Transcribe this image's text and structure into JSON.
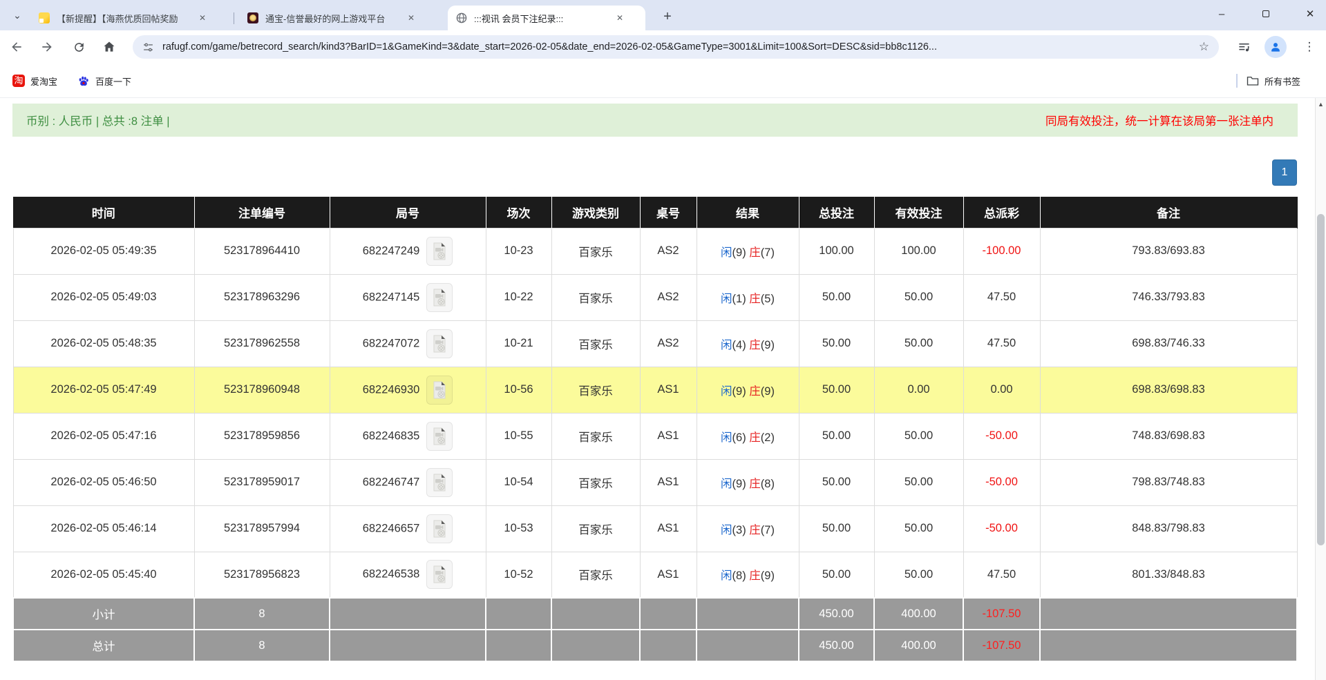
{
  "icons": {
    "chevron_down": "⌄",
    "close": "✕",
    "new_tab": "+",
    "minimize": "–",
    "star": "☆",
    "menu_dots": "⋮",
    "scroll_up": "▲",
    "taobao_glyph": "淘"
  },
  "browser": {
    "tabs": [
      {
        "title": "【新提醒】【海燕优质回帖奖励"
      },
      {
        "title": "通宝-信誉最好的网上游戏平台"
      },
      {
        "title": ":::视讯 会员下注纪录:::"
      }
    ],
    "url": "rafugf.com/game/betrecord_search/kind3?BarID=1&GameKind=3&date_start=2026-02-05&date_end=2026-02-05&GameType=3001&Limit=100&Sort=DESC&sid=bb8c1126...",
    "bookmarks": [
      "爱淘宝",
      "百度一下"
    ],
    "bookmarks_all": "所有书签"
  },
  "page": {
    "currency_summary": "币别 : 人民币 | 总共 :8 注单 |",
    "notice": "同局有效投注，统一计算在该局第一张注单内",
    "pagination": "1"
  },
  "table": {
    "headers": [
      "时间",
      "注单编号",
      "局号",
      "场次",
      "游戏类别",
      "桌号",
      "结果",
      "总投注",
      "有效投注",
      "总派彩",
      "备注"
    ],
    "rows": [
      {
        "time": "2026-02-05 05:49:35",
        "bet_id": "523178964410",
        "round_id": "682247249",
        "session": "10-23",
        "game_type": "百家乐",
        "table_no": "AS2",
        "result": {
          "pl": "闲",
          "pn": "(9)",
          "bl": "庄",
          "bn": "(7)"
        },
        "total_bet": "100.00",
        "valid_bet": "100.00",
        "payout": "-100.00",
        "remark": "793.83/693.83",
        "highlight": false
      },
      {
        "time": "2026-02-05 05:49:03",
        "bet_id": "523178963296",
        "round_id": "682247145",
        "session": "10-22",
        "game_type": "百家乐",
        "table_no": "AS2",
        "result": {
          "pl": "闲",
          "pn": "(1)",
          "bl": "庄",
          "bn": "(5)"
        },
        "total_bet": "50.00",
        "valid_bet": "50.00",
        "payout": "47.50",
        "remark": "746.33/793.83",
        "highlight": false
      },
      {
        "time": "2026-02-05 05:48:35",
        "bet_id": "523178962558",
        "round_id": "682247072",
        "session": "10-21",
        "game_type": "百家乐",
        "table_no": "AS2",
        "result": {
          "pl": "闲",
          "pn": "(4)",
          "bl": "庄",
          "bn": "(9)"
        },
        "total_bet": "50.00",
        "valid_bet": "50.00",
        "payout": "47.50",
        "remark": "698.83/746.33",
        "highlight": false
      },
      {
        "time": "2026-02-05 05:47:49",
        "bet_id": "523178960948",
        "round_id": "682246930",
        "session": "10-56",
        "game_type": "百家乐",
        "table_no": "AS1",
        "result": {
          "pl": "闲",
          "pn": "(9)",
          "bl": "庄",
          "bn": "(9)"
        },
        "total_bet": "50.00",
        "valid_bet": "0.00",
        "payout": "0.00",
        "remark": "698.83/698.83",
        "highlight": true
      },
      {
        "time": "2026-02-05 05:47:16",
        "bet_id": "523178959856",
        "round_id": "682246835",
        "session": "10-55",
        "game_type": "百家乐",
        "table_no": "AS1",
        "result": {
          "pl": "闲",
          "pn": "(6)",
          "bl": "庄",
          "bn": "(2)"
        },
        "total_bet": "50.00",
        "valid_bet": "50.00",
        "payout": "-50.00",
        "remark": "748.83/698.83",
        "highlight": false
      },
      {
        "time": "2026-02-05 05:46:50",
        "bet_id": "523178959017",
        "round_id": "682246747",
        "session": "10-54",
        "game_type": "百家乐",
        "table_no": "AS1",
        "result": {
          "pl": "闲",
          "pn": "(9)",
          "bl": "庄",
          "bn": "(8)"
        },
        "total_bet": "50.00",
        "valid_bet": "50.00",
        "payout": "-50.00",
        "remark": "798.83/748.83",
        "highlight": false
      },
      {
        "time": "2026-02-05 05:46:14",
        "bet_id": "523178957994",
        "round_id": "682246657",
        "session": "10-53",
        "game_type": "百家乐",
        "table_no": "AS1",
        "result": {
          "pl": "闲",
          "pn": "(3)",
          "bl": "庄",
          "bn": "(7)"
        },
        "total_bet": "50.00",
        "valid_bet": "50.00",
        "payout": "-50.00",
        "remark": "848.83/798.83",
        "highlight": false
      },
      {
        "time": "2026-02-05 05:45:40",
        "bet_id": "523178956823",
        "round_id": "682246538",
        "session": "10-52",
        "game_type": "百家乐",
        "table_no": "AS1",
        "result": {
          "pl": "闲",
          "pn": "(8)",
          "bl": "庄",
          "bn": "(9)"
        },
        "total_bet": "50.00",
        "valid_bet": "50.00",
        "payout": "47.50",
        "remark": "801.33/848.83",
        "highlight": false
      }
    ],
    "footer": [
      {
        "label": "小计",
        "count": "8",
        "total_bet": "450.00",
        "valid_bet": "400.00",
        "payout": "-107.50"
      },
      {
        "label": "总计",
        "count": "8",
        "total_bet": "450.00",
        "valid_bet": "400.00",
        "payout": "-107.50"
      }
    ]
  }
}
